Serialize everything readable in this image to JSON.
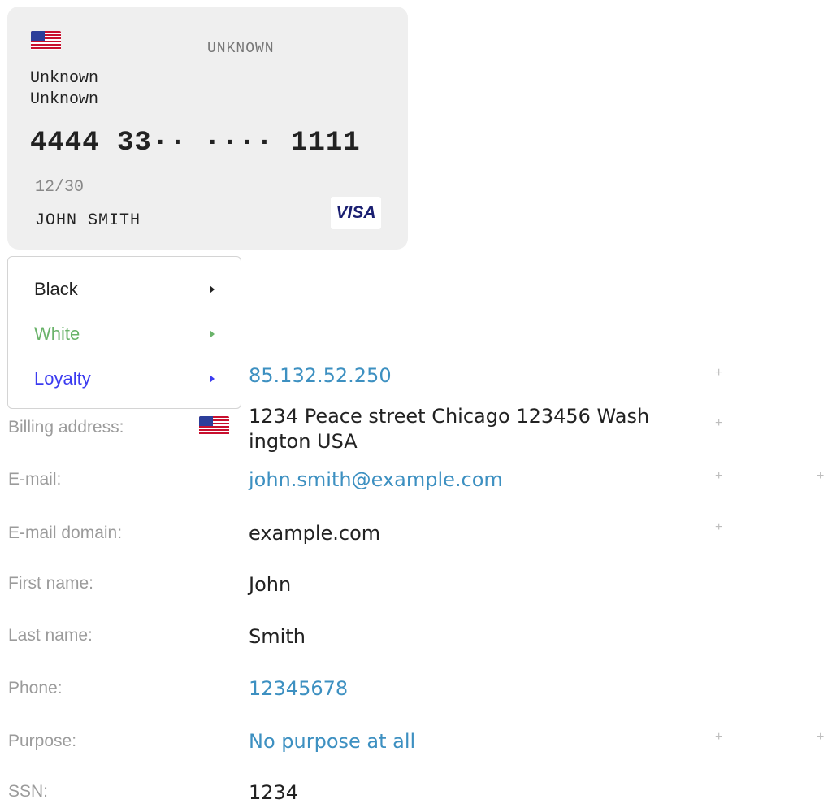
{
  "card": {
    "bank": "UNKNOWN",
    "info_line1": "Unknown",
    "info_line2": "Unknown",
    "number": "4444 33·· ···· 1111",
    "expiry": "12/30",
    "holder": "JOHN SMITH",
    "network": "VISA",
    "country_flag_icon": "us-flag-icon"
  },
  "menu": {
    "items": [
      {
        "label": "Black",
        "color": "#222222"
      },
      {
        "label": "White",
        "color": "#6ab36a"
      },
      {
        "label": "Loyalty",
        "color": "#3b3bf0"
      }
    ]
  },
  "fields": {
    "ip": {
      "value": "85.132.52.250"
    },
    "billing": {
      "label": "Billing address:",
      "value_line1": "1234 Peace street Chicago 123456 Wash",
      "value_line2": "ington USA"
    },
    "email": {
      "label": "E-mail:",
      "value": "john.smith@example.com"
    },
    "email_domain": {
      "label": "E-mail domain:",
      "value": "example.com"
    },
    "first_name": {
      "label": "First name:",
      "value": "John"
    },
    "last_name": {
      "label": "Last name:",
      "value": "Smith"
    },
    "phone": {
      "label": "Phone:",
      "value": "12345678"
    },
    "purpose": {
      "label": "Purpose:",
      "value": "No purpose at all"
    },
    "ssn": {
      "label": "SSN:",
      "value": "1234"
    }
  },
  "colors": {
    "link": "#3d90c1",
    "label": "#9b9b9b"
  },
  "plus_symbol": "+"
}
